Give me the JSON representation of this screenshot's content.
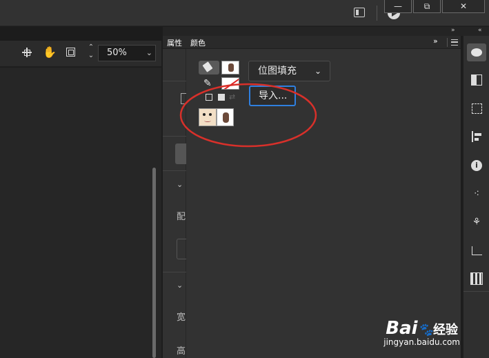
{
  "window": {
    "minimize": "—",
    "restore": "⧉",
    "close": "✕"
  },
  "toolbar": {
    "zoom_value": "50%"
  },
  "panel_tabs": {
    "properties": "属性",
    "color": "颜色",
    "collapse": "»",
    "expand": "»"
  },
  "color_panel": {
    "fill_type": "位图填充",
    "import_label": "导入..."
  },
  "properties_side": {
    "char1": "配",
    "char2": "宽",
    "char3": "高"
  },
  "annotation": {
    "color": "#d8302a"
  },
  "watermark": {
    "brand": "Bai",
    "brand_suffix": "经验",
    "url": "jingyan.baidu.com"
  },
  "icons": [
    "camera-icon",
    "play-icon",
    "crosshair-icon",
    "hand-icon",
    "frame-icon",
    "paint-bucket-icon",
    "pencil-icon",
    "palette-icon",
    "swatches-icon",
    "transform-icon",
    "align-icon",
    "info-icon",
    "motion-icon",
    "plugin-icon",
    "chart-icon",
    "library-icon"
  ]
}
